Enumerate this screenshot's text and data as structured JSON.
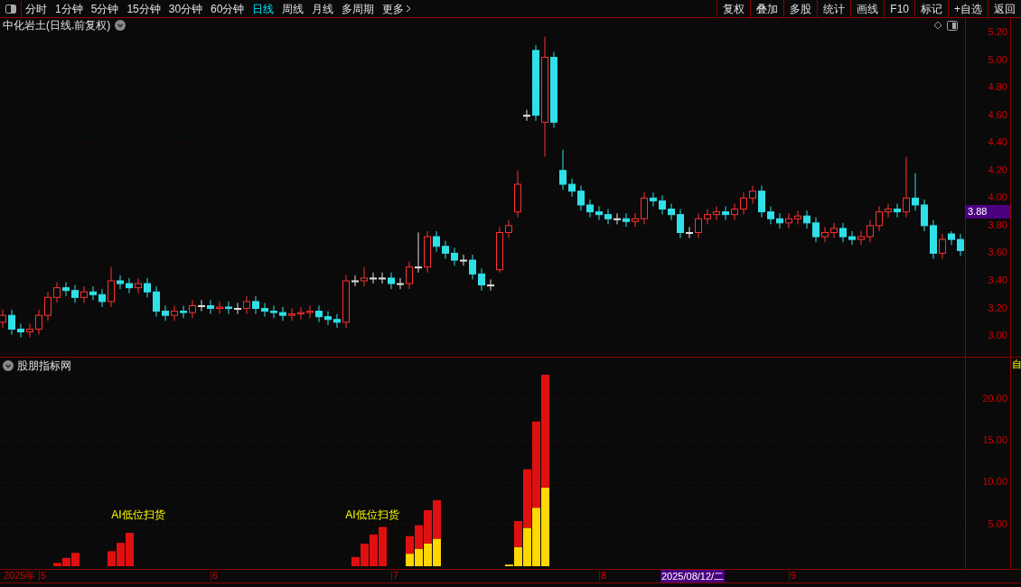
{
  "toolbar": {
    "periods": [
      {
        "label": "分时",
        "selected": false
      },
      {
        "label": "1分钟",
        "selected": false
      },
      {
        "label": "5分钟",
        "selected": false
      },
      {
        "label": "15分钟",
        "selected": false
      },
      {
        "label": "30分钟",
        "selected": false
      },
      {
        "label": "60分钟",
        "selected": false
      },
      {
        "label": "日线",
        "selected": true
      },
      {
        "label": "周线",
        "selected": false
      },
      {
        "label": "月线",
        "selected": false
      },
      {
        "label": "多周期",
        "selected": false
      }
    ],
    "more": "更多",
    "actions": [
      "复权",
      "叠加",
      "多股",
      "统计",
      "画线",
      "F10",
      "标记",
      "+自选",
      "返回"
    ]
  },
  "main_chart": {
    "title": "中化岩土(日线.前复权)",
    "current_price": "3.88",
    "chart_data": {
      "type": "candlestick",
      "grid": true,
      "ylim": [
        2.85,
        5.2
      ],
      "yticks": [
        {
          "value": 5.2,
          "label": "5.20"
        },
        {
          "value": 5.0,
          "label": "5.00"
        },
        {
          "value": 4.8,
          "label": "4.80"
        },
        {
          "value": 4.6,
          "label": "4.60"
        },
        {
          "value": 4.4,
          "label": "4.40"
        },
        {
          "value": 4.2,
          "label": "4.20"
        },
        {
          "value": 4.0,
          "label": "4.00"
        },
        {
          "value": 3.8,
          "label": "3.80"
        },
        {
          "value": 3.6,
          "label": "3.60"
        },
        {
          "value": 3.4,
          "label": "3.40"
        },
        {
          "value": 3.2,
          "label": "3.20"
        },
        {
          "value": 3.0,
          "label": "3.00"
        }
      ],
      "ohlc": [
        [
          3.1,
          3.19,
          3.06,
          3.15
        ],
        [
          3.15,
          3.19,
          3.01,
          3.05
        ],
        [
          3.05,
          3.09,
          2.99,
          3.03
        ],
        [
          3.03,
          3.09,
          2.99,
          3.05
        ],
        [
          3.05,
          3.19,
          3.01,
          3.15
        ],
        [
          3.15,
          3.32,
          3.11,
          3.28
        ],
        [
          3.28,
          3.39,
          3.24,
          3.35
        ],
        [
          3.35,
          3.39,
          3.29,
          3.33
        ],
        [
          3.33,
          3.37,
          3.24,
          3.28
        ],
        [
          3.28,
          3.36,
          3.24,
          3.32
        ],
        [
          3.32,
          3.36,
          3.26,
          3.3
        ],
        [
          3.3,
          3.34,
          3.21,
          3.25
        ],
        [
          3.25,
          3.5,
          3.21,
          3.4
        ],
        [
          3.4,
          3.44,
          3.34,
          3.38
        ],
        [
          3.38,
          3.42,
          3.31,
          3.35
        ],
        [
          3.35,
          3.42,
          3.31,
          3.38
        ],
        [
          3.38,
          3.42,
          3.28,
          3.32
        ],
        [
          3.32,
          3.36,
          3.14,
          3.18
        ],
        [
          3.18,
          3.22,
          3.11,
          3.15
        ],
        [
          3.15,
          3.22,
          3.11,
          3.18
        ],
        [
          3.18,
          3.22,
          3.13,
          3.17
        ],
        [
          3.17,
          3.26,
          3.13,
          3.22
        ],
        [
          3.22,
          3.26,
          3.18,
          3.22
        ],
        [
          3.22,
          3.26,
          3.16,
          3.2
        ],
        [
          3.2,
          3.25,
          3.16,
          3.21
        ],
        [
          3.21,
          3.25,
          3.16,
          3.2
        ],
        [
          3.2,
          3.24,
          3.16,
          3.2
        ],
        [
          3.2,
          3.29,
          3.16,
          3.25
        ],
        [
          3.25,
          3.29,
          3.16,
          3.2
        ],
        [
          3.2,
          3.24,
          3.14,
          3.18
        ],
        [
          3.18,
          3.22,
          3.13,
          3.17
        ],
        [
          3.17,
          3.21,
          3.11,
          3.15
        ],
        [
          3.15,
          3.2,
          3.11,
          3.16
        ],
        [
          3.16,
          3.21,
          3.12,
          3.17
        ],
        [
          3.17,
          3.22,
          3.13,
          3.18
        ],
        [
          3.18,
          3.22,
          3.1,
          3.14
        ],
        [
          3.14,
          3.18,
          3.08,
          3.12
        ],
        [
          3.12,
          3.16,
          3.06,
          3.1
        ],
        [
          3.1,
          3.44,
          3.06,
          3.4
        ],
        [
          3.4,
          3.44,
          3.36,
          3.4
        ],
        [
          3.4,
          3.5,
          3.36,
          3.42
        ],
        [
          3.42,
          3.46,
          3.38,
          3.42
        ],
        [
          3.42,
          3.46,
          3.38,
          3.42
        ],
        [
          3.42,
          3.46,
          3.34,
          3.38
        ],
        [
          3.38,
          3.42,
          3.34,
          3.38
        ],
        [
          3.38,
          3.54,
          3.34,
          3.5
        ],
        [
          3.5,
          3.75,
          3.46,
          3.5
        ],
        [
          3.5,
          3.76,
          3.46,
          3.72
        ],
        [
          3.72,
          3.76,
          3.61,
          3.65
        ],
        [
          3.65,
          3.69,
          3.56,
          3.6
        ],
        [
          3.6,
          3.64,
          3.51,
          3.55
        ],
        [
          3.55,
          3.59,
          3.51,
          3.55
        ],
        [
          3.55,
          3.59,
          3.41,
          3.45
        ],
        [
          3.45,
          3.49,
          3.33,
          3.37
        ],
        [
          3.37,
          3.41,
          3.33,
          3.37
        ],
        [
          3.48,
          3.79,
          3.46,
          3.75
        ],
        [
          3.75,
          3.84,
          3.71,
          3.8
        ],
        [
          3.9,
          4.2,
          3.86,
          4.1
        ],
        [
          4.6,
          4.64,
          4.56,
          4.6
        ],
        [
          5.07,
          5.11,
          4.56,
          4.6
        ],
        [
          4.55,
          5.17,
          4.3,
          5.02
        ],
        [
          5.02,
          5.06,
          4.51,
          4.55
        ],
        [
          4.2,
          4.35,
          4.06,
          4.1
        ],
        [
          4.1,
          4.14,
          4.01,
          4.05
        ],
        [
          4.05,
          4.09,
          3.91,
          3.95
        ],
        [
          3.95,
          3.99,
          3.86,
          3.9
        ],
        [
          3.9,
          3.94,
          3.84,
          3.88
        ],
        [
          3.88,
          3.92,
          3.81,
          3.85
        ],
        [
          3.85,
          3.89,
          3.81,
          3.85
        ],
        [
          3.85,
          3.89,
          3.79,
          3.83
        ],
        [
          3.83,
          3.89,
          3.79,
          3.85
        ],
        [
          3.85,
          4.04,
          3.81,
          4.0
        ],
        [
          4.0,
          4.04,
          3.94,
          3.98
        ],
        [
          3.98,
          4.02,
          3.88,
          3.92
        ],
        [
          3.92,
          3.96,
          3.84,
          3.88
        ],
        [
          3.88,
          3.92,
          3.71,
          3.75
        ],
        [
          3.75,
          3.79,
          3.71,
          3.75
        ],
        [
          3.75,
          3.89,
          3.71,
          3.85
        ],
        [
          3.85,
          3.92,
          3.81,
          3.88
        ],
        [
          3.88,
          3.94,
          3.84,
          3.9
        ],
        [
          3.9,
          3.94,
          3.84,
          3.88
        ],
        [
          3.88,
          3.96,
          3.84,
          3.92
        ],
        [
          3.92,
          4.04,
          3.88,
          4.0
        ],
        [
          4.0,
          4.09,
          3.96,
          4.05
        ],
        [
          4.05,
          4.09,
          3.86,
          3.9
        ],
        [
          3.9,
          3.94,
          3.81,
          3.85
        ],
        [
          3.85,
          3.89,
          3.78,
          3.82
        ],
        [
          3.82,
          3.89,
          3.78,
          3.85
        ],
        [
          3.85,
          3.91,
          3.81,
          3.87
        ],
        [
          3.87,
          3.91,
          3.78,
          3.82
        ],
        [
          3.82,
          3.86,
          3.68,
          3.72
        ],
        [
          3.72,
          3.79,
          3.68,
          3.75
        ],
        [
          3.75,
          3.82,
          3.71,
          3.78
        ],
        [
          3.78,
          3.82,
          3.68,
          3.72
        ],
        [
          3.72,
          3.76,
          3.66,
          3.7
        ],
        [
          3.7,
          3.76,
          3.66,
          3.72
        ],
        [
          3.72,
          3.84,
          3.68,
          3.8
        ],
        [
          3.8,
          3.94,
          3.76,
          3.9
        ],
        [
          3.9,
          3.96,
          3.86,
          3.92
        ],
        [
          3.92,
          3.96,
          3.86,
          3.9
        ],
        [
          3.9,
          4.3,
          3.86,
          4.0
        ],
        [
          4.0,
          4.18,
          3.91,
          3.95
        ],
        [
          3.95,
          3.99,
          3.76,
          3.8
        ],
        [
          3.8,
          3.84,
          3.56,
          3.6
        ],
        [
          3.6,
          3.74,
          3.56,
          3.7
        ],
        [
          3.74,
          3.76,
          3.66,
          3.7
        ],
        [
          3.7,
          3.74,
          3.58,
          3.62
        ]
      ]
    }
  },
  "indicator": {
    "title": "股朋指标网",
    "signals": [
      "AI低位扫货",
      "AI低位扫货"
    ],
    "side_label": "自",
    "chart_data": {
      "type": "bar",
      "stacked": true,
      "grid": true,
      "categories": [
        null,
        null,
        null,
        null,
        "5",
        null,
        null,
        null,
        null,
        null,
        null,
        null,
        null,
        null,
        null,
        null,
        null,
        null,
        null,
        null,
        null,
        null,
        null,
        "6",
        null,
        null,
        null,
        null,
        null,
        null,
        null,
        null,
        null,
        null,
        null,
        null,
        null,
        null,
        null,
        null,
        null,
        null,
        null,
        "7",
        null,
        null,
        null,
        null,
        null,
        null,
        null,
        null,
        null,
        null,
        null,
        null,
        null,
        null,
        null,
        null,
        null,
        null,
        null,
        null,
        null,
        null,
        "8",
        null,
        null,
        null,
        null,
        null,
        null,
        null,
        null,
        null,
        null,
        null,
        null,
        null,
        null,
        null,
        null,
        null,
        null,
        null,
        null,
        "9",
        null,
        null,
        null,
        null,
        null,
        null,
        null,
        null,
        null,
        null,
        null,
        null,
        null,
        null,
        null,
        null,
        null,
        null,
        null
      ],
      "series": [
        {
          "color": "#ffd700",
          "values": [
            null,
            null,
            null,
            null,
            null,
            null,
            null,
            null,
            null,
            null,
            null,
            null,
            null,
            null,
            null,
            null,
            null,
            null,
            null,
            null,
            null,
            null,
            null,
            null,
            null,
            null,
            null,
            null,
            null,
            null,
            null,
            null,
            null,
            null,
            null,
            null,
            null,
            null,
            null,
            null,
            null,
            null,
            null,
            null,
            null,
            1.5,
            2.1,
            2.7,
            3.3,
            null,
            null,
            null,
            null,
            null,
            null,
            null,
            0.2,
            2.3,
            4.6,
            7.0,
            9.4,
            null,
            null,
            null,
            null,
            null,
            null,
            null,
            null,
            null,
            null,
            null,
            null,
            null,
            null,
            null,
            null,
            null,
            null,
            null,
            null,
            null,
            null,
            null,
            null,
            null,
            null,
            null,
            null,
            null,
            null,
            null,
            null,
            null,
            null,
            null,
            null,
            null,
            null,
            null,
            null,
            null,
            null,
            null,
            null,
            null,
            null
          ]
        },
        {
          "color": "#e01010",
          "values": [
            null,
            null,
            null,
            null,
            null,
            null,
            0.4,
            1.0,
            1.6,
            null,
            null,
            null,
            1.8,
            2.8,
            4.0,
            null,
            null,
            null,
            null,
            null,
            null,
            null,
            null,
            null,
            null,
            null,
            null,
            null,
            null,
            null,
            null,
            null,
            null,
            null,
            null,
            null,
            null,
            null,
            null,
            1.1,
            2.7,
            3.8,
            4.7,
            null,
            null,
            2.1,
            2.8,
            4.0,
            4.6,
            null,
            null,
            null,
            null,
            null,
            null,
            null,
            null,
            3.1,
            7.0,
            10.3,
            13.5,
            null,
            null,
            null,
            null,
            null,
            null,
            null,
            null,
            null,
            null,
            null,
            null,
            null,
            null,
            null,
            null,
            null,
            null,
            null,
            null,
            null,
            null,
            null,
            null,
            null,
            null,
            null,
            null,
            null,
            null,
            null,
            null,
            null,
            null,
            null,
            null,
            null,
            null,
            null,
            null,
            null,
            null,
            null,
            null,
            null,
            null
          ]
        }
      ],
      "ylim": [
        0,
        23
      ],
      "yticks": [
        {
          "value": 5,
          "label": "5.00"
        },
        {
          "value": 10,
          "label": "10.00"
        },
        {
          "value": 15,
          "label": "15.00"
        },
        {
          "value": 20,
          "label": "20.00"
        }
      ]
    }
  },
  "time_axis": {
    "year": "2025年",
    "cursor_date": "2025/08/12/二"
  }
}
